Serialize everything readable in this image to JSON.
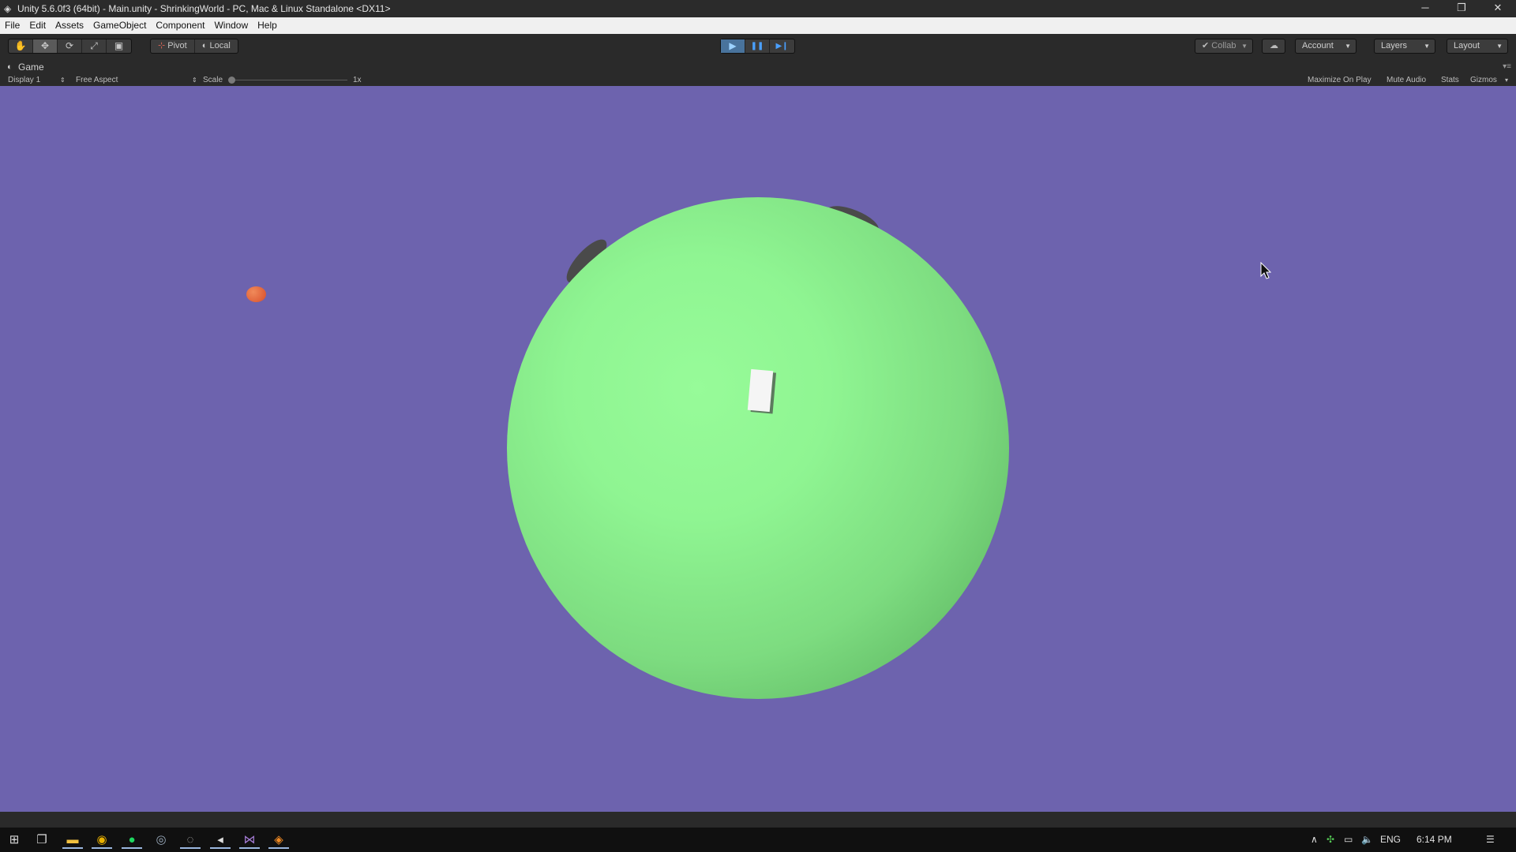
{
  "window": {
    "title": "Unity 5.6.0f3 (64bit) - Main.unity - ShrinkingWorld - PC, Mac & Linux Standalone <DX11>",
    "controls": {
      "minimize": "─",
      "restore": "❐",
      "close": "✕"
    }
  },
  "menu": [
    "File",
    "Edit",
    "Assets",
    "GameObject",
    "Component",
    "Window",
    "Help"
  ],
  "toolbar": {
    "tools": [
      {
        "name": "hand-tool",
        "glyph": "✋"
      },
      {
        "name": "move-tool",
        "glyph": "✥"
      },
      {
        "name": "rotate-tool",
        "glyph": "⟳"
      },
      {
        "name": "scale-tool",
        "glyph": "⤢"
      },
      {
        "name": "rect-tool",
        "glyph": "▣"
      }
    ],
    "pivot_label": "Pivot",
    "local_label": "Local",
    "play": {
      "play": "▶",
      "pause": "❚❚",
      "step": "▶❙"
    },
    "collab_label": "Collab",
    "cloud_glyph": "☁",
    "account_label": "Account",
    "layers_label": "Layers",
    "layout_label": "Layout"
  },
  "game_panel": {
    "tab_label": "Game",
    "display_label": "Display 1",
    "aspect_label": "Free Aspect",
    "scale_label": "Scale",
    "scale_value": "1x",
    "maximize_label": "Maximize On Play",
    "mute_label": "Mute Audio",
    "stats_label": "Stats",
    "gizmos_label": "Gizmos"
  },
  "colors": {
    "sky": "#6d63ae",
    "planet": "#8ff592",
    "food": "#e06a3c",
    "tree": "#4a4a4a",
    "player": "#f5f5f5"
  },
  "taskbar": {
    "apps": [
      "windows-start-icon",
      "task-view-icon",
      "file-explorer-icon",
      "chrome-icon",
      "spotify-icon",
      "app-icon",
      "unity-hub-icon",
      "unity-icon",
      "visual-studio-icon",
      "blender-icon"
    ],
    "language": "ENG",
    "time": "6:14 PM"
  }
}
